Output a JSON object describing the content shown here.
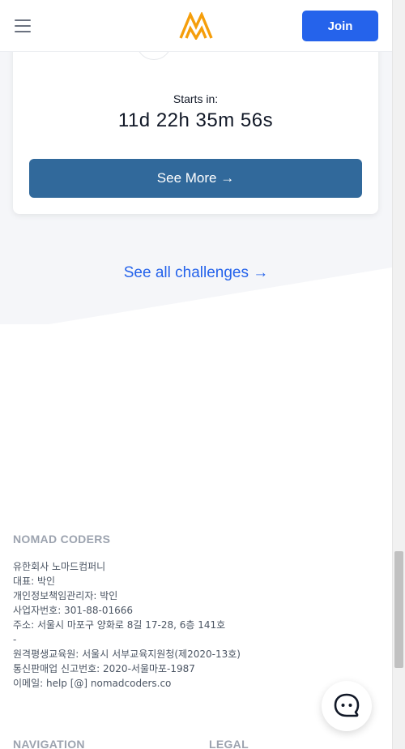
{
  "header": {
    "menu_icon": "hamburger-menu-icon",
    "logo_icon": "nomad-coders-logo",
    "join_label": "Join",
    "accent_color": "#2563eb",
    "logo_color": "#f59e0b"
  },
  "challenge_card": {
    "starts_label": "Starts in:",
    "countdown": "11d 22h 35m 56s",
    "see_more_label": "See More →",
    "button_color": "#31699b"
  },
  "see_all_challenges": "See all challenges →",
  "footer": {
    "company_title": "NOMAD CODERS",
    "company_lines": [
      "유한회사 노마드컴퍼니",
      "대표: 박인",
      "개인정보책임관리자: 박인",
      "사업자번호: 301-88-01666",
      "주소: 서울시 마포구 양화로 8길 17-28, 6층 141호",
      "-",
      "원격평생교육원: 서울시 서부교육지원청(제2020-13호)",
      "통신판매업 신고번호: 2020-서울마포-1987",
      "이메일: help [@] nomadcoders.co"
    ],
    "navigation_title": "NAVIGATION",
    "legal_title": "LEGAL"
  },
  "chat": {
    "icon": "chat-bubble-icon"
  }
}
